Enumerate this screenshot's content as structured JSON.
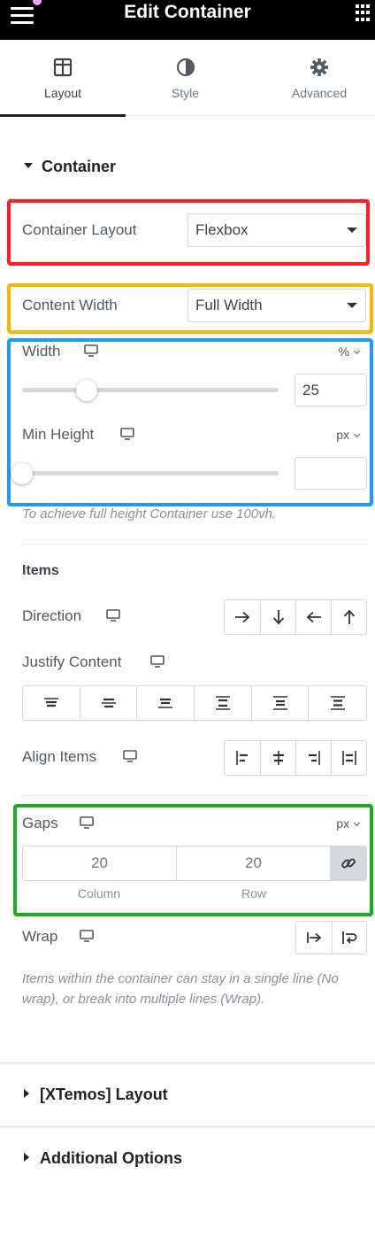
{
  "header": {
    "title": "Edit Container"
  },
  "tabs": [
    {
      "label": "Layout",
      "icon": "layout-icon",
      "active": true
    },
    {
      "label": "Style",
      "icon": "half-circle-icon",
      "active": false
    },
    {
      "label": "Advanced",
      "icon": "gear-icon",
      "active": false
    }
  ],
  "container_section": {
    "title": "Container",
    "container_layout": {
      "label": "Container Layout",
      "value": "Flexbox"
    },
    "content_width": {
      "label": "Content Width",
      "value": "Full Width"
    },
    "width": {
      "label": "Width",
      "unit": "%",
      "value": "25",
      "slider_fraction": 0.25
    },
    "min_height": {
      "label": "Min Height",
      "unit": "px",
      "value": "",
      "slider_fraction": 0
    },
    "min_height_hint": "To achieve full height Container use 100vh."
  },
  "items_section": {
    "title": "Items",
    "direction": {
      "label": "Direction",
      "options": [
        "row-icon",
        "column-icon",
        "row-reverse-icon",
        "column-reverse-icon"
      ]
    },
    "justify_content": {
      "label": "Justify Content",
      "options": [
        "justify-start-icon",
        "justify-center-icon",
        "justify-end-icon",
        "justify-space-between-icon",
        "justify-space-around-icon",
        "justify-space-evenly-icon"
      ]
    },
    "align_items": {
      "label": "Align Items",
      "options": [
        "align-start-icon",
        "align-center-icon",
        "align-end-icon",
        "align-stretch-icon"
      ]
    },
    "gaps": {
      "label": "Gaps",
      "unit": "px",
      "column": "20",
      "row": "20",
      "column_label": "Column",
      "row_label": "Row"
    },
    "wrap": {
      "label": "Wrap",
      "options": [
        "no-wrap-icon",
        "wrap-icon"
      ]
    },
    "wrap_hint": "Items within the container can stay in a single line (No wrap), or break into multiple lines (Wrap)."
  },
  "collapsed_sections": [
    {
      "title": "[XTemos] Layout"
    },
    {
      "title": "Additional Options"
    }
  ],
  "colors": {
    "highlight_red": "#ff1f1f",
    "highlight_yellow": "#ffb400",
    "highlight_blue": "#1e9bf0",
    "highlight_green": "#1aad1a"
  }
}
